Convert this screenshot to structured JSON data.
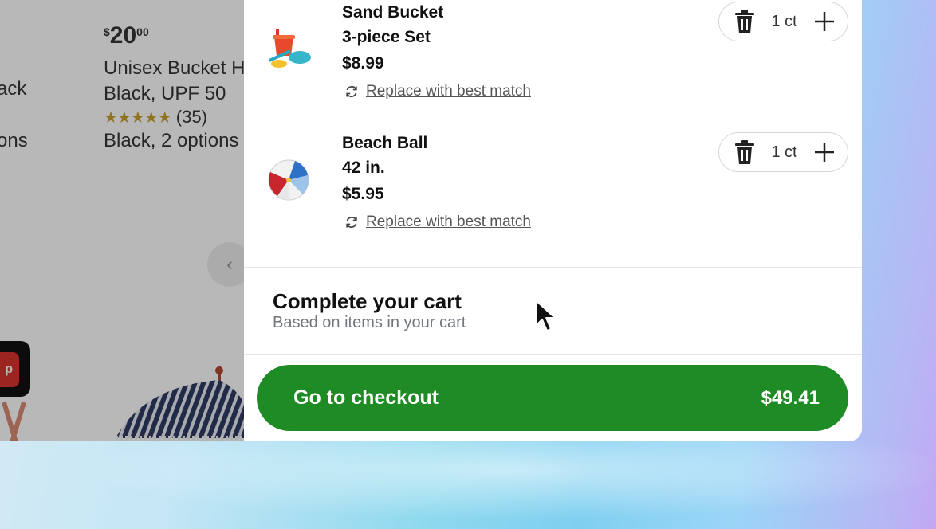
{
  "background_page": {
    "left_partial_1": "ack",
    "left_partial_2": "ons",
    "price_currency": "$",
    "price_dollars": "20",
    "price_cents": "00",
    "product_title_line1": "Unisex Bucket H",
    "product_title_line2": "Black, UPF 50",
    "rating_stars": "★★★★★",
    "rating_count": "(35)",
    "options_text": "Black, 2 options",
    "red_chip_text": "p"
  },
  "cart": {
    "items": [
      {
        "name_line1": "Sand Bucket",
        "name_line2": "3-piece Set",
        "price": "$8.99",
        "replace_label": "Replace with best match",
        "quantity": "1 ct"
      },
      {
        "name_line1": "Beach Ball",
        "name_line2": "42 in.",
        "price": "$5.95",
        "replace_label": "Replace with best match",
        "quantity": "1 ct"
      }
    ],
    "complete_title": "Complete your cart",
    "complete_subtitle": "Based on items in your cart",
    "checkout_label": "Go to checkout",
    "checkout_total": "$49.41"
  },
  "colors": {
    "checkout_green": "#1f8b24",
    "star_gold": "#c8a12e",
    "badge_red": "#d9322e"
  },
  "icons": [
    "trash-icon",
    "plus-icon",
    "refresh-icon",
    "chevron-left-icon",
    "mouse-pointer-icon"
  ]
}
